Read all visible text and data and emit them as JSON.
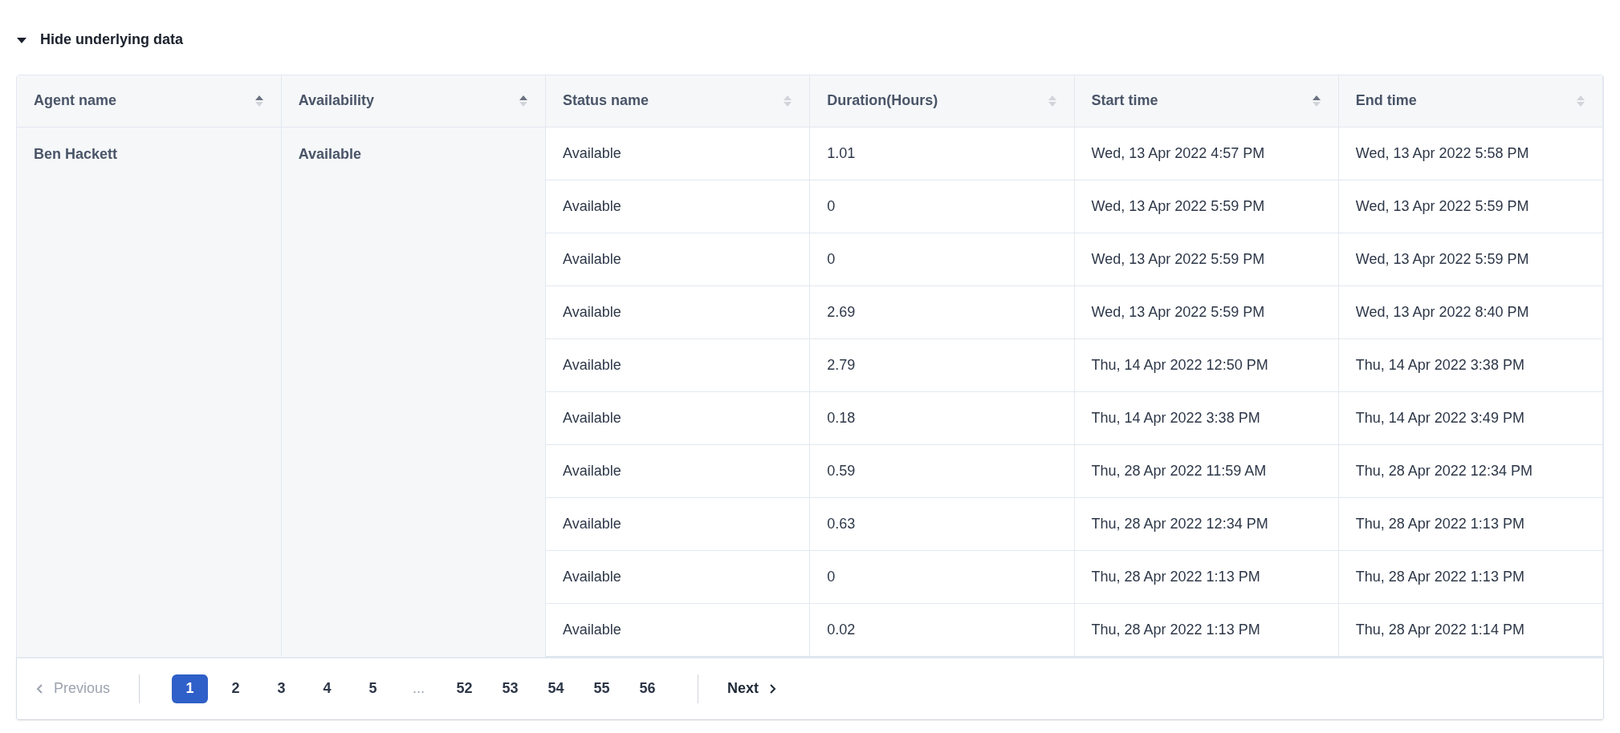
{
  "toggle": {
    "label": "Hide underlying data",
    "expanded": true
  },
  "table": {
    "columns": [
      {
        "label": "Agent name",
        "sorted": true
      },
      {
        "label": "Availability",
        "sorted": true
      },
      {
        "label": "Status name",
        "sorted": false
      },
      {
        "label": "Duration(Hours)",
        "sorted": false
      },
      {
        "label": "Start time",
        "sorted": true
      },
      {
        "label": "End time",
        "sorted": false
      }
    ],
    "rows": [
      [
        {
          "text": "Ben Hackett",
          "rowspan": 10
        },
        {
          "text": "Available",
          "rowspan": 10
        },
        "Available",
        "1.01",
        "Wed, 13 Apr 2022 4:57 PM",
        "Wed, 13 Apr 2022 5:58 PM"
      ],
      [
        "Available",
        "0",
        "Wed, 13 Apr 2022 5:59 PM",
        "Wed, 13 Apr 2022 5:59 PM"
      ],
      [
        "Available",
        "0",
        "Wed, 13 Apr 2022 5:59 PM",
        "Wed, 13 Apr 2022 5:59 PM"
      ],
      [
        "Available",
        "2.69",
        "Wed, 13 Apr 2022 5:59 PM",
        "Wed, 13 Apr 2022 8:40 PM"
      ],
      [
        "Available",
        "2.79",
        "Thu, 14 Apr 2022 12:50 PM",
        "Thu, 14 Apr 2022 3:38 PM"
      ],
      [
        "Available",
        "0.18",
        "Thu, 14 Apr 2022 3:38 PM",
        "Thu, 14 Apr 2022 3:49 PM"
      ],
      [
        "Available",
        "0.59",
        "Thu, 28 Apr 2022 11:59 AM",
        "Thu, 28 Apr 2022 12:34 PM"
      ],
      [
        "Available",
        "0.63",
        "Thu, 28 Apr 2022 12:34 PM",
        "Thu, 28 Apr 2022 1:13 PM"
      ],
      [
        "Available",
        "0",
        "Thu, 28 Apr 2022 1:13 PM",
        "Thu, 28 Apr 2022 1:13 PM"
      ],
      [
        "Available",
        "0.02",
        "Thu, 28 Apr 2022 1:13 PM",
        "Thu, 28 Apr 2022 1:14 PM"
      ]
    ]
  },
  "pagination": {
    "previous": {
      "label": "Previous",
      "disabled": true
    },
    "pages": [
      {
        "kind": "page",
        "label": "1",
        "selected": true
      },
      {
        "kind": "page",
        "label": "2",
        "selected": false
      },
      {
        "kind": "page",
        "label": "3",
        "selected": false
      },
      {
        "kind": "page",
        "label": "4",
        "selected": false
      },
      {
        "kind": "page",
        "label": "5",
        "selected": false
      },
      {
        "kind": "ellipsis",
        "label": "..."
      },
      {
        "kind": "page",
        "label": "52",
        "selected": false
      },
      {
        "kind": "page",
        "label": "53",
        "selected": false
      },
      {
        "kind": "page",
        "label": "54",
        "selected": false
      },
      {
        "kind": "page",
        "label": "55",
        "selected": false
      },
      {
        "kind": "page",
        "label": "56",
        "selected": false
      }
    ],
    "next": {
      "label": "Next",
      "disabled": false
    }
  }
}
